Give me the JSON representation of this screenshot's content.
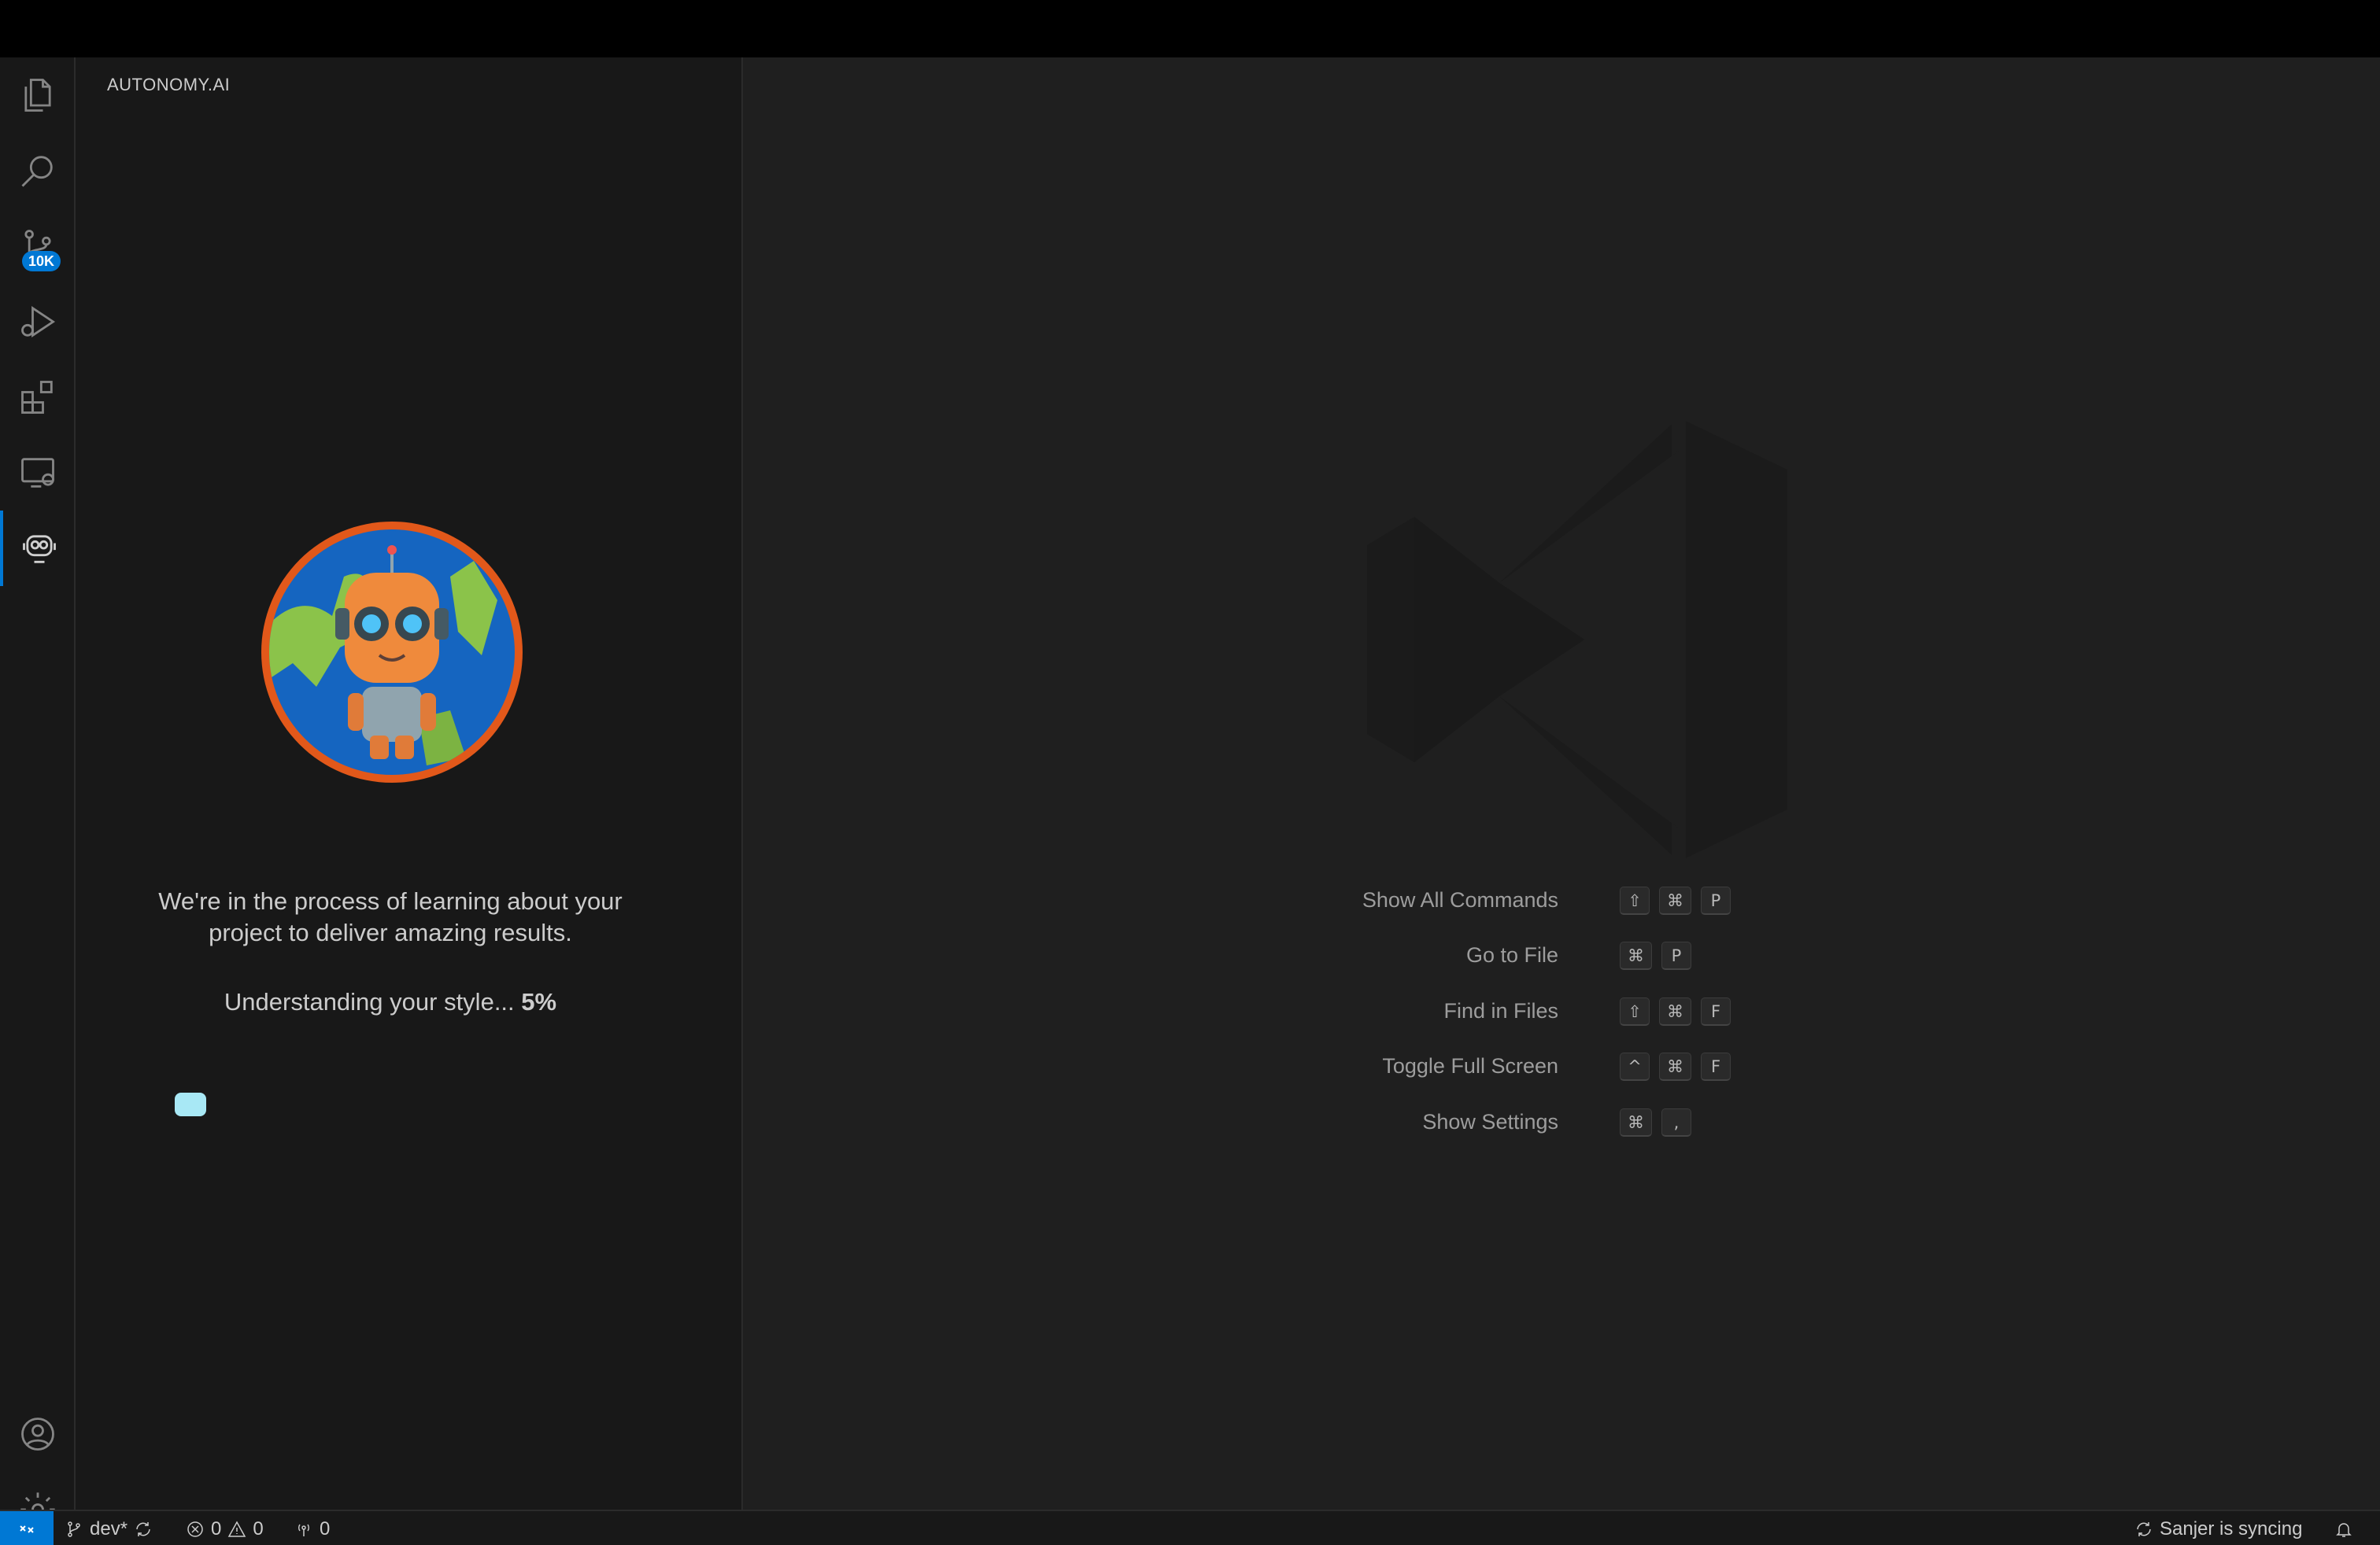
{
  "sidebar": {
    "title": "AUTONOMY.AI",
    "scm_badge": "10K",
    "learning_text": "We're in the process of learning about your project to deliver amazing results.",
    "progress_label": "Understanding your style...",
    "progress_value": "5%"
  },
  "editor": {
    "shortcuts": [
      {
        "label": "Show All Commands",
        "keys": [
          "⇧",
          "⌘",
          "P"
        ]
      },
      {
        "label": "Go to File",
        "keys": [
          "⌘",
          "P"
        ]
      },
      {
        "label": "Find in Files",
        "keys": [
          "⇧",
          "⌘",
          "F"
        ]
      },
      {
        "label": "Toggle Full Screen",
        "keys": [
          "^",
          "⌘",
          "F"
        ]
      },
      {
        "label": "Show Settings",
        "keys": [
          "⌘",
          ","
        ]
      }
    ]
  },
  "statusbar": {
    "branch": "dev*",
    "errors": "0",
    "warnings": "0",
    "ports": "0",
    "sync_status": "Sanjer is syncing"
  },
  "colors": {
    "accent": "#0078d4",
    "progress": "#a8e8f5",
    "mascot_ring": "#e2581a"
  }
}
